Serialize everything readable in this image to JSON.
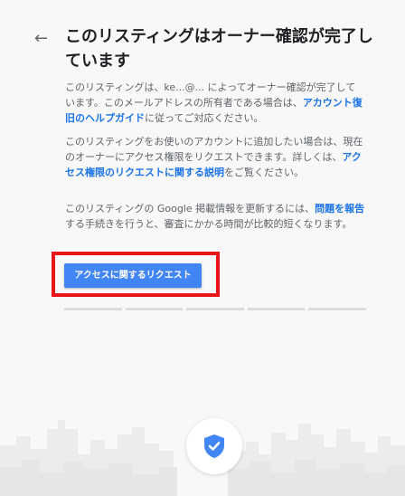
{
  "header": {
    "back_icon": "arrow-left-icon",
    "title": "このリスティングはオーナー確認が完了しています"
  },
  "body": {
    "p1_text_a": "このリスティングは、ke...@... によってオーナー確認が完了しています。このメールアドレスの所有者である場合は、",
    "p1_link": "アカウント復旧のヘルプガイド",
    "p1_text_b": "に従ってご対応ください。",
    "p2_text_a": "このリスティングをお使いのアカウントに追加したい場合は、現在のオーナーにアクセス権限をリクエストできます。詳しくは、",
    "p2_link": "アクセス権限のリクエストに関する説明",
    "p2_text_b": "をご覧ください。",
    "p3_text_a": "このリスティングの Google 掲載情報を更新するには、",
    "p3_link": "問題を報告",
    "p3_text_b": "する手続きを行うと、審査にかかる時間が比較的短くなります。"
  },
  "actions": {
    "request_button_label": "アクセスに関するリクエスト"
  },
  "footer": {
    "badge_icon": "shield-check-icon"
  },
  "colors": {
    "accent": "#4285f4",
    "link": "#1a73e8",
    "highlight": "#e8151b"
  }
}
